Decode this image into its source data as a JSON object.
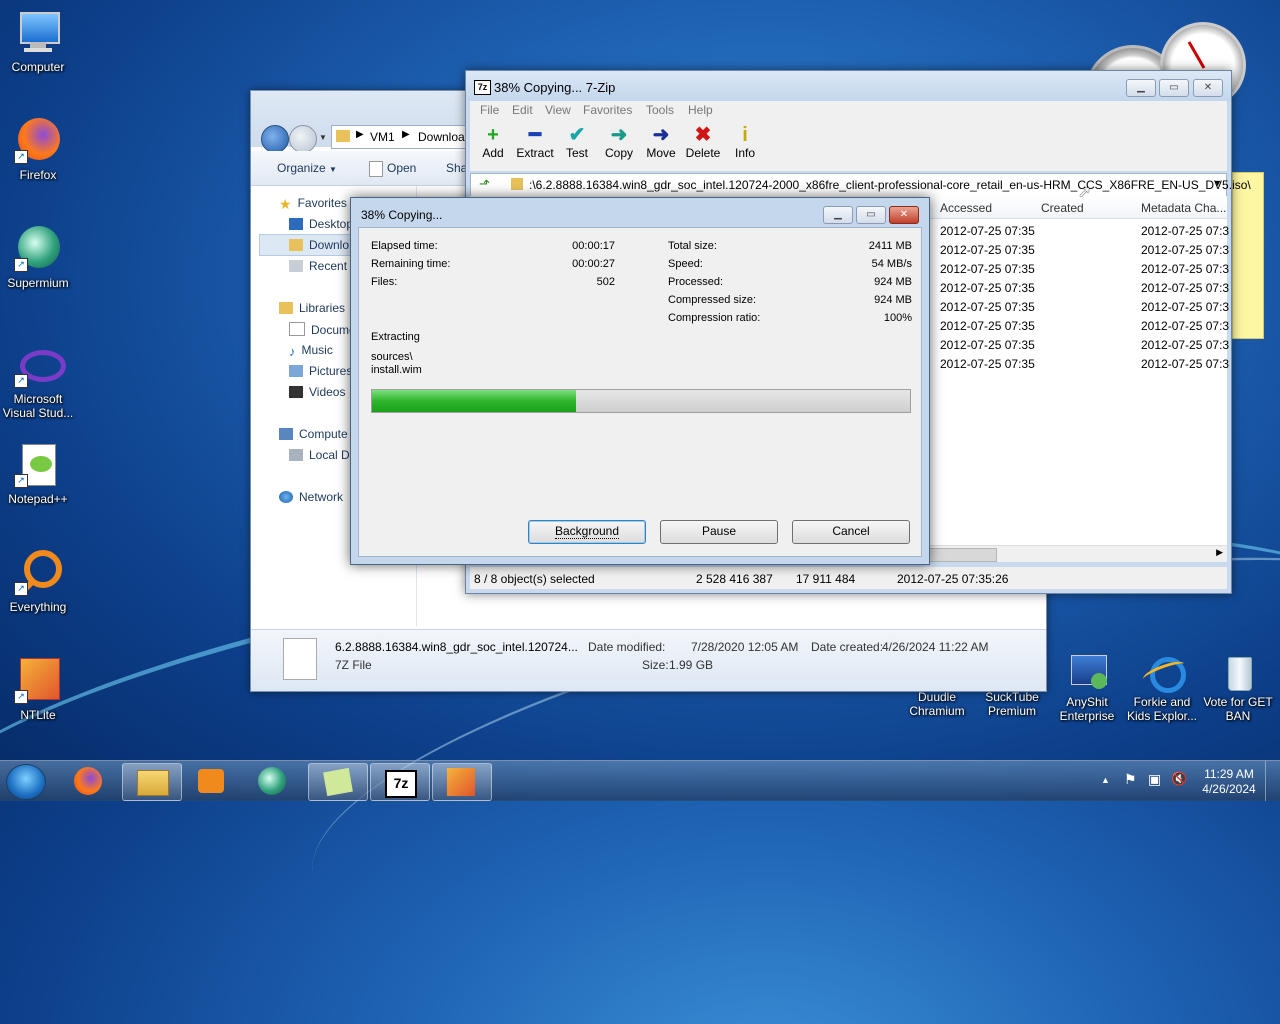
{
  "desktop": {
    "icons_left": [
      {
        "label": "Computer"
      },
      {
        "label": "Firefox"
      },
      {
        "label": "Supermium"
      },
      {
        "label": "Microsoft Visual Stud..."
      },
      {
        "label": "Notepad++"
      },
      {
        "label": "Everything"
      },
      {
        "label": "NTLite"
      }
    ],
    "icons_bottom": [
      {
        "label": "Duudle Chramium"
      },
      {
        "label": "SuckTube Premium"
      },
      {
        "label": "AnyShit Enterprise"
      },
      {
        "label": "Forkie and Kids Explor..."
      },
      {
        "label": "Vote for GET BAN"
      }
    ]
  },
  "explorer": {
    "breadcrumb": [
      "VM1",
      "Downloa"
    ],
    "toolbar": {
      "organize": "Organize",
      "open": "Open",
      "share": "Sha"
    },
    "nav": {
      "favorites": "Favorites",
      "desktop": "Desktop",
      "downloads": "Downlo",
      "recent": "Recent P",
      "libraries": "Libraries",
      "documents": "Docume",
      "music": "Music",
      "pictures": "Pictures",
      "videos": "Videos",
      "computer": "Compute",
      "local_disk": "Local Di",
      "network": "Network"
    },
    "details": {
      "filename": "6.2.8888.16384.win8_gdr_soc_intel.120724...",
      "filetype": "7Z File",
      "date_modified_label": "Date modified:",
      "date_modified": "7/28/2020 12:05 AM",
      "date_created_label": "Date created:",
      "date_created": "4/26/2024 11:22 AM",
      "size_label": "Size:",
      "size": "1.99 GB"
    }
  },
  "zip": {
    "title": "38% Copying... 7-Zip",
    "icon_text": "7z",
    "menu": [
      "File",
      "Edit",
      "View",
      "Favorites",
      "Tools",
      "Help"
    ],
    "tools": [
      {
        "label": "Add",
        "symbol": "+",
        "color": "#1fa81f"
      },
      {
        "label": "Extract",
        "symbol": "━",
        "color": "#1b3fb5"
      },
      {
        "label": "Test",
        "symbol": "✔",
        "color": "#1aa6a6"
      },
      {
        "label": "Copy",
        "symbol": "➜",
        "color": "#1a9a8a"
      },
      {
        "label": "Move",
        "symbol": "➜",
        "color": "#1b2f9b"
      },
      {
        "label": "Delete",
        "symbol": "✖",
        "color": "#d01515"
      },
      {
        "label": "Info",
        "symbol": "i",
        "color": "#c9a800"
      }
    ],
    "path": ":\\6.2.8888.16384.win8_gdr_soc_intel.120724-2000_x86fre_client-professional-core_retail_en-us-HRM_CCS_X86FRE_EN-US_DV5.iso\\",
    "columns": {
      "accessed": "Accessed",
      "created": "Created",
      "metadata": "Metadata Cha..."
    },
    "rows": [
      {
        "accessed": "2012-07-25 07:35",
        "metadata": "2012-07-25 07:3"
      },
      {
        "accessed": "2012-07-25 07:35",
        "metadata": "2012-07-25 07:3"
      },
      {
        "accessed": "2012-07-25 07:35",
        "metadata": "2012-07-25 07:3"
      },
      {
        "accessed": "2012-07-25 07:35",
        "metadata": "2012-07-25 07:3"
      },
      {
        "accessed": "2012-07-25 07:35",
        "metadata": "2012-07-25 07:3"
      },
      {
        "accessed": "2012-07-25 07:35",
        "metadata": "2012-07-25 07:3"
      },
      {
        "accessed": "2012-07-25 07:35",
        "metadata": "2012-07-25 07:3"
      },
      {
        "accessed": "2012-07-25 07:35",
        "metadata": "2012-07-25 07:3"
      }
    ],
    "status": {
      "selected": "8 / 8 object(s) selected",
      "size": "2 528 416 387",
      "packed": "17 911 484",
      "modified": "2012-07-25 07:35:26"
    }
  },
  "dialog": {
    "title": "38% Copying...",
    "left": [
      {
        "label": "Elapsed time:",
        "value": "00:00:17"
      },
      {
        "label": "Remaining time:",
        "value": "00:00:27"
      },
      {
        "label": "Files:",
        "value": "502"
      }
    ],
    "right": [
      {
        "label": "Total size:",
        "value": "2411 MB"
      },
      {
        "label": "Speed:",
        "value": "54 MB/s"
      },
      {
        "label": "Processed:",
        "value": "924 MB"
      },
      {
        "label": "Compressed size:",
        "value": "924 MB"
      },
      {
        "label": "Compression ratio:",
        "value": "100%"
      }
    ],
    "operation": "Extracting",
    "current_dir": "sources\\",
    "current_file": "install.wim",
    "progress": 0.38,
    "buttons": {
      "background": "Background",
      "pause": "Pause",
      "cancel": "Cancel"
    }
  },
  "taskbar": {
    "clock_time": "11:29 AM",
    "clock_date": "4/26/2024",
    "tray_up": "▲",
    "tray_flag": "⚑",
    "tray_net": "▣",
    "tray_sound": "🔇"
  }
}
